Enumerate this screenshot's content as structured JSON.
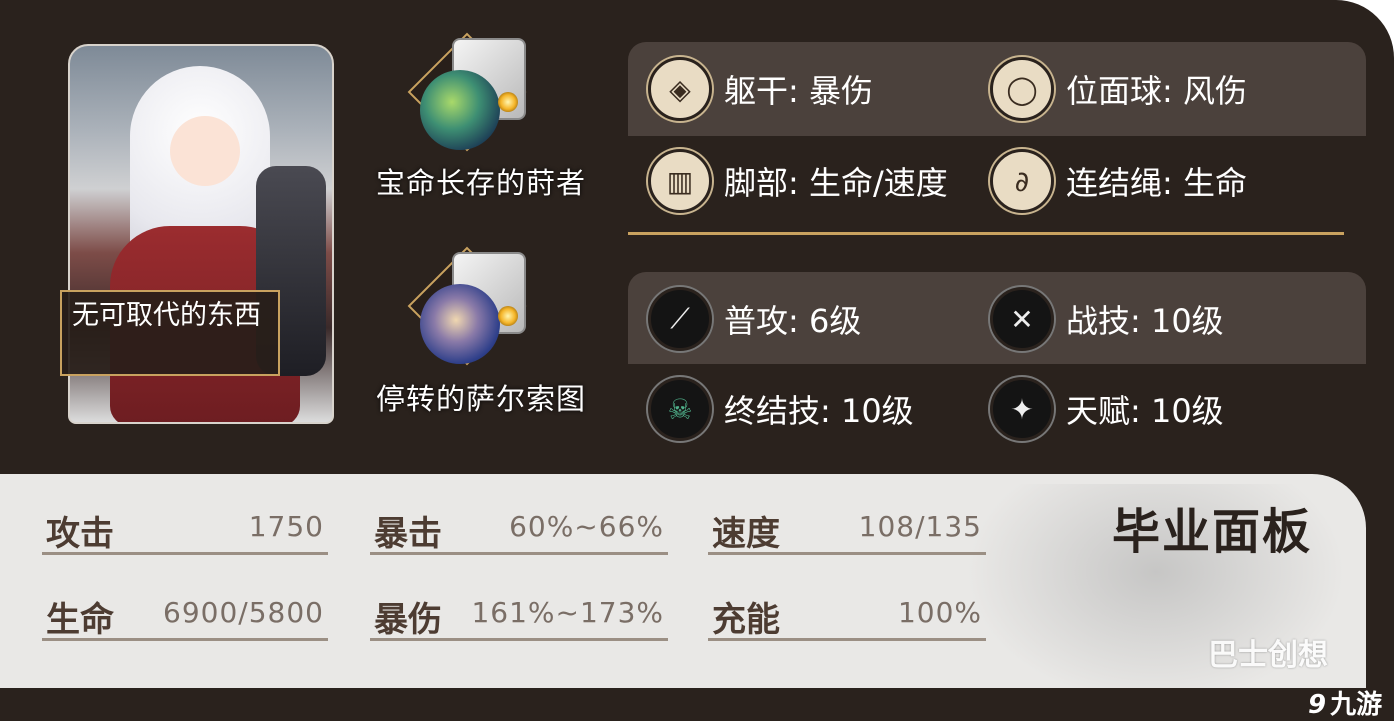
{
  "character": {
    "light_cone_name": "无可取代的东西"
  },
  "relics": [
    {
      "name": "宝命长存的莳者"
    },
    {
      "name": "停转的萨尔索图"
    }
  ],
  "main_stats": [
    {
      "label": "躯干: 暴伤",
      "icon": "body-armor-icon"
    },
    {
      "label": "位面球: 风伤",
      "icon": "ring-orb-icon"
    },
    {
      "label": "脚部: 生命/速度",
      "icon": "boots-icon"
    },
    {
      "label": "连结绳: 生命",
      "icon": "link-rope-icon"
    }
  ],
  "skills": [
    {
      "label": "普攻: 6级",
      "icon": "basic-attack-icon"
    },
    {
      "label": "战技: 10级",
      "icon": "skill-icon"
    },
    {
      "label": "终结技: 10级",
      "icon": "ultimate-icon"
    },
    {
      "label": "天赋: 10级",
      "icon": "talent-icon"
    }
  ],
  "final_panel": {
    "title": "毕业面板",
    "stats": [
      {
        "label": "攻击",
        "value": "1750"
      },
      {
        "label": "暴击",
        "value": "60%~66%"
      },
      {
        "label": "速度",
        "value": "108/135"
      },
      {
        "label": "生命",
        "value": "6900/5800"
      },
      {
        "label": "暴伤",
        "value": "161%~173%"
      },
      {
        "label": "充能",
        "value": "100%"
      }
    ]
  },
  "watermarks": {
    "bashi": "巴士创想",
    "jiuyou": "九游",
    "jiuyou_mark": "9"
  },
  "colors": {
    "background": "#2a221d",
    "panel": "#4b413c",
    "gold_accent": "#c9a25f",
    "bottom_panel": "#e9e8e6"
  }
}
